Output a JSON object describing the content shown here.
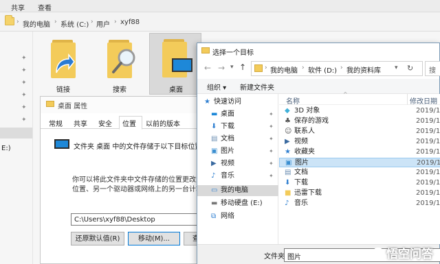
{
  "explorer": {
    "ribbon_tabs": [
      "共享",
      "查看"
    ],
    "breadcrumb": [
      "我的电脑",
      "系统 (C:)",
      "用户",
      "xyf88"
    ],
    "folders": [
      {
        "label": "链接",
        "icon": "link-arrow-icon"
      },
      {
        "label": "搜索",
        "icon": "search-icon"
      },
      {
        "label": "桌面",
        "icon": "desktop-icon"
      }
    ],
    "left_fragment": "E:)"
  },
  "properties_dialog": {
    "title": "桌面 属性",
    "tabs": [
      "常规",
      "共享",
      "安全",
      "位置",
      "以前的版本"
    ],
    "active_tab": "位置",
    "description": "文件夹 桌面 中的文件存储于以下目标位置。",
    "info_line1": "你可以将此文件夹中文件存储的位置更改为此硬",
    "info_line2": "位置、另一个驱动器或网络上的另一台计算机。",
    "path_value": "C:\\Users\\xyf88\\Desktop",
    "restore_button": "还原默认值(R)",
    "move_button": "移动(M)...",
    "find_button": "查"
  },
  "browse_dialog": {
    "title": "选择一个目标",
    "address": [
      "我的电脑",
      "软件 (D:)",
      "我的资料库"
    ],
    "refresh_fragment": "搜",
    "toolbar": {
      "organize": "组织",
      "new_folder": "新建文件夹"
    },
    "nav": [
      {
        "label": "快速访问",
        "icon": "star-icon",
        "pinned": false
      },
      {
        "label": "桌面",
        "icon": "desktop-icon",
        "pinned": true
      },
      {
        "label": "下载",
        "icon": "download-icon",
        "pinned": true
      },
      {
        "label": "文档",
        "icon": "document-icon",
        "pinned": true
      },
      {
        "label": "图片",
        "icon": "picture-icon",
        "pinned": true
      },
      {
        "label": "视频",
        "icon": "video-icon",
        "pinned": true
      },
      {
        "label": "音乐",
        "icon": "music-icon",
        "pinned": true
      },
      {
        "label": "我的电脑",
        "icon": "computer-icon",
        "pinned": false,
        "selected": true
      },
      {
        "label": "移动硬盘 (E:)",
        "icon": "drive-icon",
        "pinned": false
      },
      {
        "label": "网络",
        "icon": "network-icon",
        "pinned": false
      }
    ],
    "columns": {
      "name": "名称",
      "modified": "修改日期"
    },
    "items": [
      {
        "name": "3D 对象",
        "date": "2019/1/",
        "icon": "cube-icon"
      },
      {
        "name": "保存的游戏",
        "date": "2019/1/",
        "icon": "game-icon"
      },
      {
        "name": "联系人",
        "date": "2019/1/",
        "icon": "contacts-icon"
      },
      {
        "name": "视频",
        "date": "2019/1/",
        "icon": "video-icon"
      },
      {
        "name": "收藏夹",
        "date": "2019/1/",
        "icon": "star-icon"
      },
      {
        "name": "图片",
        "date": "2019/1/",
        "icon": "picture-icon",
        "selected": true
      },
      {
        "name": "文档",
        "date": "2019/1/",
        "icon": "document-icon"
      },
      {
        "name": "下载",
        "date": "2019/1/",
        "icon": "download-icon"
      },
      {
        "name": "迅雷下载",
        "date": "2019/1/",
        "icon": "folder-icon"
      },
      {
        "name": "音乐",
        "date": "2019/1/",
        "icon": "music-icon"
      }
    ],
    "folder_label": "文件夹:",
    "folder_value": "图片"
  },
  "watermark": "悟空问答",
  "colors": {
    "accent": "#0078d7",
    "selection": "#cce4f7",
    "folder": "#f5d36b"
  }
}
